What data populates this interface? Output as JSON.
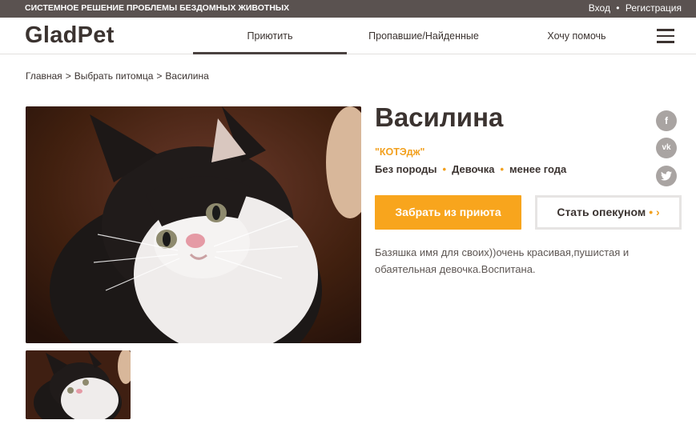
{
  "topbar": {
    "tagline": "СИСТЕМНОЕ РЕШЕНИЕ ПРОБЛЕМЫ БЕЗДОМНЫХ ЖИВОТНЫХ",
    "login": "Вход",
    "separator": "•",
    "register": "Регистрация"
  },
  "header": {
    "logo": "GladPet",
    "nav": [
      {
        "label": "Приютить"
      },
      {
        "label": "Пропавшие/Найденные"
      },
      {
        "label": "Хочу помочь"
      }
    ]
  },
  "breadcrumb": {
    "items": [
      "Главная",
      "Выбрать питомца",
      "Василина"
    ],
    "separator": ">"
  },
  "pet": {
    "name": "Василина",
    "shelter": "\"КОТЭдж\"",
    "traits": [
      "Без породы",
      "Девочка",
      "менее года"
    ],
    "trait_separator": "•",
    "description": "Базяшка имя для своих))очень красивая,пушистая и обаятельная девочка.Воспитана."
  },
  "actions": {
    "adopt_label": "Забрать из приюта",
    "guardian_label": "Стать опекуном",
    "guardian_arrow": "• ›"
  },
  "social": {
    "facebook": "f",
    "vk": "vk",
    "twitter": "t"
  },
  "colors": {
    "accent": "#f8a51d",
    "topbar": "#5a5250",
    "text": "#3b3330"
  }
}
